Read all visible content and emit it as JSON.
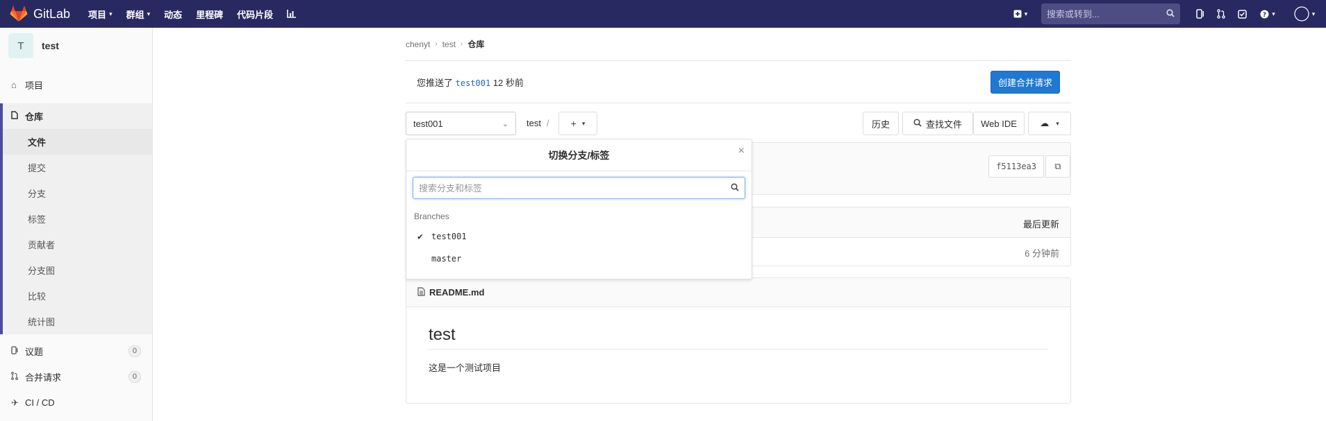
{
  "navbar": {
    "brand": "GitLab",
    "links": [
      {
        "label": "项目",
        "caret": true
      },
      {
        "label": "群组",
        "caret": true
      },
      {
        "label": "动态",
        "caret": false
      },
      {
        "label": "里程碑",
        "caret": false
      },
      {
        "label": "代码片段",
        "caret": false
      }
    ],
    "search_placeholder": "搜索或转到..."
  },
  "sidebar": {
    "project_avatar": "T",
    "project_name": "test",
    "items": [
      {
        "label": "项目"
      },
      {
        "label": "仓库"
      },
      {
        "label": "议题",
        "count": "0"
      },
      {
        "label": "合并请求",
        "count": "0"
      },
      {
        "label": "CI / CD"
      }
    ],
    "repo_subitems": [
      "文件",
      "提交",
      "分支",
      "标签",
      "贡献者",
      "分支图",
      "比较",
      "统计图"
    ]
  },
  "breadcrumb": [
    "chenyt",
    "test",
    "仓库"
  ],
  "push_banner": {
    "prefix": "您推送了",
    "branch": "test001",
    "time": "12 秒前",
    "button": "创建合并请求"
  },
  "controls": {
    "branch": "test001",
    "path": "test",
    "path_sep": "/",
    "history": "历史",
    "find_file": "查找文件",
    "web_ide": "Web IDE"
  },
  "commit": {
    "sha": "f5113ea3"
  },
  "file_table": {
    "last_update_header": "最后更新",
    "row_time": "6 分钟前"
  },
  "readme": {
    "filename": "README.md",
    "heading": "test",
    "body": "这是一个测试项目"
  },
  "dropdown": {
    "title": "切换分支/标签",
    "search_placeholder": "搜索分支和标签",
    "section": "Branches",
    "branches": [
      {
        "name": "test001",
        "selected": true
      },
      {
        "name": "master",
        "selected": false
      }
    ]
  }
}
